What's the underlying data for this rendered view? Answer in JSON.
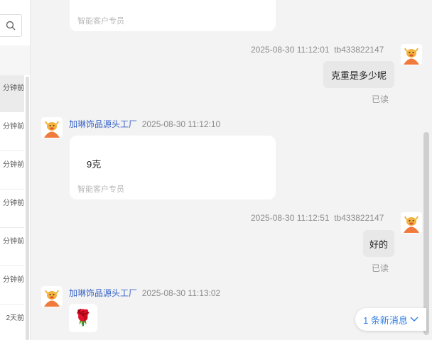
{
  "sidebar": {
    "items": [
      {
        "time": "分钟前"
      },
      {
        "time": "分钟前"
      },
      {
        "time": "分钟前"
      },
      {
        "time": "分钟前"
      },
      {
        "time": "分钟前"
      },
      {
        "time": "分钟前"
      },
      {
        "time": "2天前"
      }
    ]
  },
  "messages": [
    {
      "signature": "智能客户专员"
    },
    {
      "time": "2025-08-30 11:12:01",
      "user": "tb433822147",
      "text": "克重是多少呢",
      "status": "已读"
    },
    {
      "sender": "加琳饰品源头工厂",
      "time": "2025-08-30 11:12:10",
      "text": "9克",
      "signature": "智能客户专员"
    },
    {
      "time": "2025-08-30 11:12:51",
      "user": "tb433822147",
      "text": "好的",
      "status": "已读"
    },
    {
      "sender": "加琳饰品源头工厂",
      "time": "2025-08-30 11:13:02",
      "emoji": "🌹"
    }
  ],
  "new_message_label": "1 条新消息",
  "colors": {
    "sender": "#3a64c8",
    "accent": "#2f7de1",
    "avatar": "#f07a3c"
  }
}
